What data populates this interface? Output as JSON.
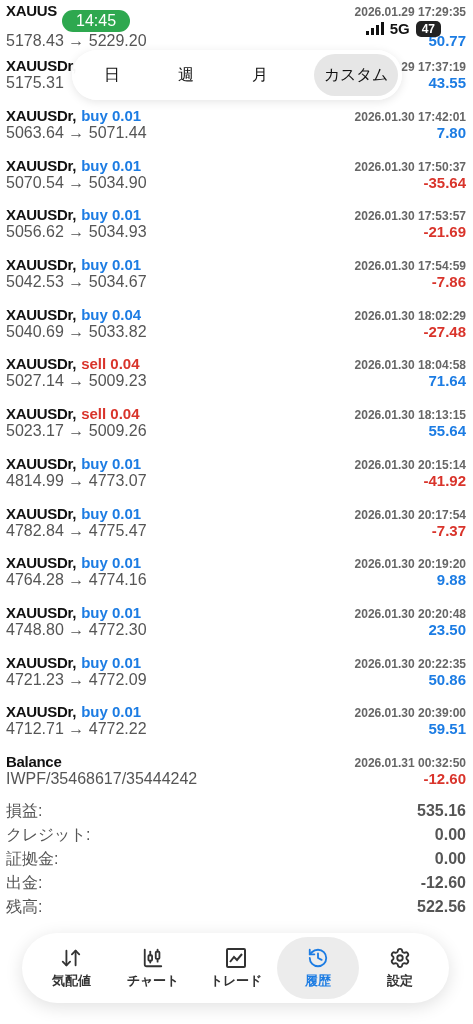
{
  "status_bar": {
    "time": "14:45",
    "network": "5G",
    "battery": "47"
  },
  "period_tabs": [
    {
      "label": "日",
      "selected": false
    },
    {
      "label": "週",
      "selected": false
    },
    {
      "label": "月",
      "selected": false
    },
    {
      "label": "カスタム",
      "selected": true
    }
  ],
  "deals": [
    {
      "symbol": "XAUUS",
      "time": "2026.01.29 17:29:35",
      "prices": "5178.43 → 5229.20",
      "profit": "50.77",
      "loss": false
    },
    {
      "symbol": "XAUUSDr,",
      "time": "29 17:37:19",
      "prices": "5175.31",
      "profit": "43.55",
      "loss": false
    },
    {
      "symbol": "XAUUSDr,",
      "color": "#1c7ce3",
      "trade": "buy 0.01",
      "time": "2026.01.30 17:42:01",
      "prices": "5063.64 → 5071.44",
      "profit": "7.80",
      "loss": false
    },
    {
      "symbol": "XAUUSDr,",
      "color": "#1c7ce3",
      "trade": "buy 0.01",
      "time": "2026.01.30 17:50:37",
      "prices": "5070.54 → 5034.90",
      "profit": "-35.64",
      "loss": true
    },
    {
      "symbol": "XAUUSDr,",
      "color": "#1c7ce3",
      "trade": "buy 0.01",
      "time": "2026.01.30 17:53:57",
      "prices": "5056.62 → 5034.93",
      "profit": "-21.69",
      "loss": true
    },
    {
      "symbol": "XAUUSDr,",
      "color": "#1c7ce3",
      "trade": "buy 0.01",
      "time": "2026.01.30 17:54:59",
      "prices": "5042.53 → 5034.67",
      "profit": "-7.86",
      "loss": true
    },
    {
      "symbol": "XAUUSDr,",
      "color": "#1c7ce3",
      "trade": "buy 0.04",
      "time": "2026.01.30 18:02:29",
      "prices": "5040.69 → 5033.82",
      "profit": "-27.48",
      "loss": true
    },
    {
      "symbol": "XAUUSDr,",
      "color": "#d9342b",
      "trade": "sell 0.04",
      "time": "2026.01.30 18:04:58",
      "prices": "5027.14 → 5009.23",
      "profit": "71.64",
      "loss": false
    },
    {
      "symbol": "XAUUSDr,",
      "color": "#d9342b",
      "trade": "sell 0.04",
      "time": "2026.01.30 18:13:15",
      "prices": "5023.17 → 5009.26",
      "profit": "55.64",
      "loss": false
    },
    {
      "symbol": "XAUUSDr,",
      "color": "#1c7ce3",
      "trade": "buy 0.01",
      "time": "2026.01.30 20:15:14",
      "prices": "4814.99 → 4773.07",
      "profit": "-41.92",
      "loss": true
    },
    {
      "symbol": "XAUUSDr,",
      "color": "#1c7ce3",
      "trade": "buy 0.01",
      "time": "2026.01.30 20:17:54",
      "prices": "4782.84 → 4775.47",
      "profit": "-7.37",
      "loss": true
    },
    {
      "symbol": "XAUUSDr,",
      "color": "#1c7ce3",
      "trade": "buy 0.01",
      "time": "2026.01.30 20:19:20",
      "prices": "4764.28 → 4774.16",
      "profit": "9.88",
      "loss": false
    },
    {
      "symbol": "XAUUSDr,",
      "color": "#1c7ce3",
      "trade": "buy 0.01",
      "time": "2026.01.30 20:20:48",
      "prices": "4748.80 → 4772.30",
      "profit": "23.50",
      "loss": false
    },
    {
      "symbol": "XAUUSDr,",
      "color": "#1c7ce3",
      "trade": "buy 0.01",
      "time": "2026.01.30 20:22:35",
      "prices": "4721.23 → 4772.09",
      "profit": "50.86",
      "loss": false
    },
    {
      "symbol": "XAUUSDr,",
      "color": "#1c7ce3",
      "trade": "buy 0.01",
      "time": "2026.01.30 20:39:00",
      "prices": "4712.71 → 4772.22",
      "profit": "59.51",
      "loss": false
    },
    {
      "symbol": "Balance",
      "time": "2026.01.31 00:32:50",
      "prices": "IWPF/35468617/35444242",
      "profit": "-12.60",
      "loss": true
    }
  ],
  "summary": [
    {
      "label": "損益:",
      "value": "535.16"
    },
    {
      "label": "クレジット:",
      "value": "0.00"
    },
    {
      "label": "証拠金:",
      "value": "0.00"
    },
    {
      "label": "出金:",
      "value": "-12.60"
    },
    {
      "label": "残高:",
      "value": "522.56"
    }
  ],
  "nav": [
    {
      "label": "気配値",
      "selected": false
    },
    {
      "label": "チャート",
      "selected": false
    },
    {
      "label": "トレード",
      "selected": false
    },
    {
      "label": "履歴",
      "selected": true
    },
    {
      "label": "設定",
      "selected": false
    }
  ]
}
